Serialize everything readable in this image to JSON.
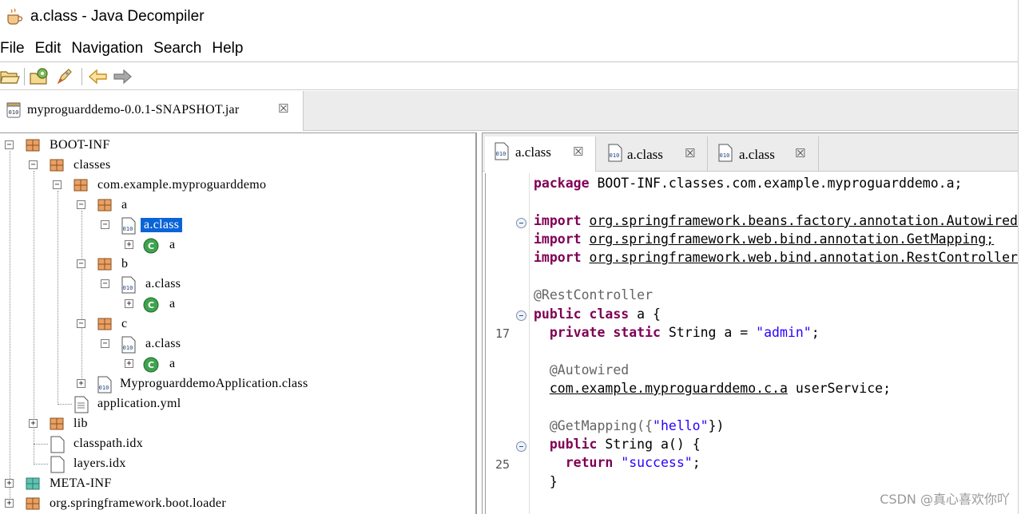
{
  "window": {
    "title": "a.class - Java Decompiler",
    "icon": "coffee-cup-icon"
  },
  "menu": [
    "File",
    "Edit",
    "Navigation",
    "Search",
    "Help"
  ],
  "toolbar": {
    "buttons": [
      "open-folder-icon",
      "open-type-icon",
      "search-rocket-icon",
      "back-arrow-icon",
      "forward-arrow-icon"
    ]
  },
  "file_tab": {
    "label": "myproguarddemo-0.0.1-SNAPSHOT.jar",
    "close": "☒"
  },
  "tree": {
    "nodes": [
      {
        "label": "BOOT-INF"
      },
      {
        "label": "classes"
      },
      {
        "label": "com.example.myproguarddemo"
      },
      {
        "label": "a"
      },
      {
        "label": "a.class",
        "selected": true
      },
      {
        "label": "a"
      },
      {
        "label": "b"
      },
      {
        "label": "a.class"
      },
      {
        "label": "a"
      },
      {
        "label": "c"
      },
      {
        "label": "a.class"
      },
      {
        "label": "a"
      },
      {
        "label": "MyproguarddemoApplication.class"
      },
      {
        "label": "application.yml"
      },
      {
        "label": "lib"
      },
      {
        "label": "classpath.idx"
      },
      {
        "label": "layers.idx"
      },
      {
        "label": "META-INF"
      },
      {
        "label": "org.springframework.boot.loader"
      }
    ]
  },
  "editor_tabs": [
    {
      "label": "a.class",
      "active": true
    },
    {
      "label": "a.class",
      "active": false
    },
    {
      "label": "a.class",
      "active": false
    }
  ],
  "code": {
    "line_numbers": [
      "17",
      "25"
    ],
    "package_kw": "package",
    "package_name": "BOOT-INF.classes.com.example.myproguarddemo.a;",
    "import_kw": "import",
    "imports": [
      "org.springframework.beans.factory.annotation.Autowired;",
      "org.springframework.web.bind.annotation.GetMapping;",
      "org.springframework.web.bind.annotation.RestController;"
    ],
    "rest_controller": "@RestController",
    "class_decl_kw": "public class",
    "class_decl_rest": " a {",
    "field_kw": "private static",
    "field_rest": " String a = ",
    "field_value": "\"admin\"",
    "field_end": ";",
    "autowired": "@Autowired",
    "service_type": "com.example.myproguarddemo.c.a",
    "service_rest": " userService;",
    "getmapping_open": "@GetMapping({",
    "getmapping_value": "\"hello\"",
    "getmapping_close": "})",
    "method_kw": "public",
    "method_rest": " String a() {",
    "return_kw": "return",
    "return_value": "\"success\"",
    "return_end": ";",
    "close_brace": "}"
  },
  "watermark": "CSDN @真心喜欢你吖"
}
